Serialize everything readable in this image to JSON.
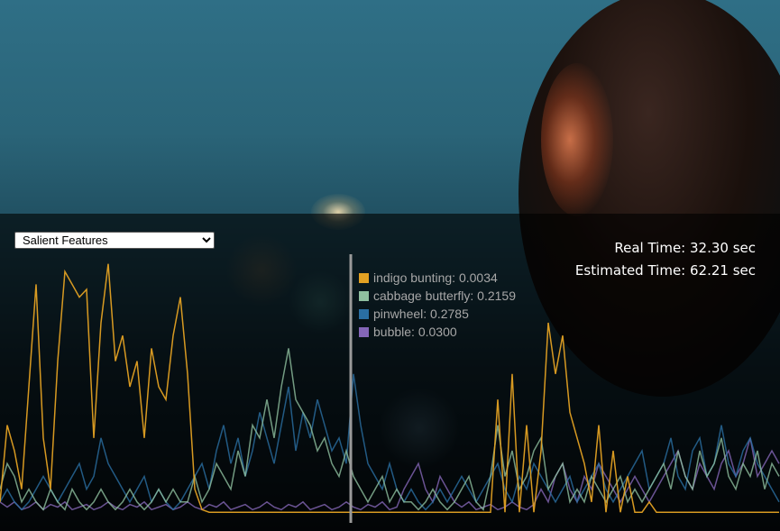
{
  "selector": {
    "selected": "Salient Features"
  },
  "timing": {
    "real_time": "Real Time: 32.30 sec",
    "estimated_time": "Estimated Time: 62.21 sec"
  },
  "legend": [
    {
      "label": "indigo bunting: 0.0034",
      "color": "#e3a123"
    },
    {
      "label": "cabbage butterfly: 0.2159",
      "color": "#8fbf9f"
    },
    {
      "label": "pinwheel: 0.2785",
      "color": "#2a6fa3"
    },
    {
      "label": "bubble: 0.0300",
      "color": "#8466b7"
    }
  ],
  "chart_data": {
    "type": "line",
    "ylim": [
      0,
      1
    ],
    "x": [
      0,
      8,
      16,
      24,
      32,
      40,
      48,
      56,
      64,
      72,
      80,
      88,
      96,
      104,
      112,
      120,
      128,
      136,
      144,
      152,
      160,
      168,
      176,
      184,
      192,
      200,
      208,
      216,
      224,
      232,
      240,
      248,
      256,
      264,
      272,
      280,
      288,
      296,
      304,
      312,
      320,
      328,
      336,
      344,
      352,
      360,
      368,
      376,
      384,
      392,
      400,
      408,
      416,
      424,
      432,
      440,
      448,
      456,
      464,
      472,
      480,
      488,
      496,
      504,
      512,
      520,
      528,
      536,
      544,
      552,
      560,
      568,
      576,
      584,
      592,
      600,
      608,
      616,
      624,
      632,
      640,
      648,
      656,
      664,
      672,
      680,
      688,
      696,
      704,
      712,
      720,
      728,
      736,
      744,
      752,
      760,
      768,
      776,
      784,
      792,
      800,
      808,
      816,
      824,
      832,
      840,
      848,
      856,
      864
    ],
    "playhead_x": 389,
    "series": [
      {
        "name": "indigo bunting",
        "color": "#e3a123",
        "values": [
          0.05,
          0.35,
          0.25,
          0.1,
          0.5,
          0.9,
          0.3,
          0.1,
          0.6,
          0.95,
          0.9,
          0.85,
          0.88,
          0.3,
          0.75,
          0.98,
          0.6,
          0.7,
          0.5,
          0.6,
          0.3,
          0.65,
          0.5,
          0.45,
          0.7,
          0.85,
          0.55,
          0.1,
          0.02,
          0.01,
          0.01,
          0.01,
          0.01,
          0.01,
          0.01,
          0.01,
          0.01,
          0.01,
          0.01,
          0.01,
          0.01,
          0.01,
          0.01,
          0.01,
          0.01,
          0.01,
          0.01,
          0.01,
          0.01,
          0.01,
          0.01,
          0.01,
          0.01,
          0.01,
          0.01,
          0.01,
          0.01,
          0.01,
          0.01,
          0.01,
          0.01,
          0.01,
          0.01,
          0.01,
          0.01,
          0.01,
          0.01,
          0.01,
          0.01,
          0.45,
          0.01,
          0.55,
          0.01,
          0.35,
          0.01,
          0.25,
          0.75,
          0.55,
          0.7,
          0.4,
          0.3,
          0.2,
          0.05,
          0.35,
          0.01,
          0.25,
          0.01,
          0.15,
          0.01,
          0.01,
          0.05,
          0.01,
          0.01,
          0.01,
          0.01,
          0.01,
          0.01,
          0.01,
          0.01,
          0.01,
          0.01,
          0.01,
          0.01,
          0.01,
          0.01,
          0.01,
          0.01,
          0.01,
          0.01
        ]
      },
      {
        "name": "cabbage butterfly",
        "color": "#8fbf9f",
        "values": [
          0.1,
          0.2,
          0.15,
          0.05,
          0.1,
          0.05,
          0.02,
          0.1,
          0.05,
          0.02,
          0.1,
          0.05,
          0.02,
          0.05,
          0.1,
          0.05,
          0.02,
          0.05,
          0.1,
          0.05,
          0.02,
          0.05,
          0.1,
          0.05,
          0.1,
          0.05,
          0.05,
          0.15,
          0.05,
          0.1,
          0.2,
          0.15,
          0.1,
          0.25,
          0.15,
          0.35,
          0.3,
          0.45,
          0.3,
          0.5,
          0.65,
          0.45,
          0.4,
          0.35,
          0.25,
          0.3,
          0.2,
          0.15,
          0.25,
          0.15,
          0.1,
          0.05,
          0.1,
          0.15,
          0.05,
          0.1,
          0.05,
          0.05,
          0.02,
          0.05,
          0.1,
          0.05,
          0.02,
          0.05,
          0.1,
          0.15,
          0.05,
          0.02,
          0.15,
          0.35,
          0.15,
          0.25,
          0.1,
          0.15,
          0.25,
          0.3,
          0.1,
          0.15,
          0.2,
          0.05,
          0.1,
          0.05,
          0.15,
          0.1,
          0.05,
          0.1,
          0.15,
          0.05,
          0.1,
          0.05,
          0.1,
          0.15,
          0.2,
          0.1,
          0.25,
          0.15,
          0.1,
          0.25,
          0.15,
          0.2,
          0.3,
          0.15,
          0.1,
          0.2,
          0.15,
          0.25,
          0.1,
          0.2,
          0.15
        ]
      },
      {
        "name": "pinwheel",
        "color": "#2a6fa3",
        "values": [
          0.05,
          0.1,
          0.05,
          0.02,
          0.05,
          0.1,
          0.15,
          0.1,
          0.05,
          0.1,
          0.15,
          0.2,
          0.1,
          0.15,
          0.3,
          0.2,
          0.15,
          0.1,
          0.05,
          0.1,
          0.15,
          0.05,
          0.1,
          0.05,
          0.02,
          0.05,
          0.1,
          0.15,
          0.2,
          0.1,
          0.25,
          0.35,
          0.2,
          0.3,
          0.15,
          0.25,
          0.4,
          0.3,
          0.2,
          0.35,
          0.5,
          0.25,
          0.4,
          0.3,
          0.45,
          0.35,
          0.25,
          0.3,
          0.2,
          0.55,
          0.35,
          0.2,
          0.15,
          0.1,
          0.2,
          0.1,
          0.05,
          0.1,
          0.05,
          0.02,
          0.05,
          0.1,
          0.05,
          0.1,
          0.15,
          0.1,
          0.05,
          0.1,
          0.15,
          0.2,
          0.1,
          0.05,
          0.15,
          0.1,
          0.2,
          0.15,
          0.1,
          0.05,
          0.1,
          0.15,
          0.05,
          0.1,
          0.15,
          0.2,
          0.1,
          0.05,
          0.1,
          0.15,
          0.2,
          0.25,
          0.1,
          0.15,
          0.2,
          0.3,
          0.15,
          0.1,
          0.25,
          0.3,
          0.15,
          0.2,
          0.35,
          0.2,
          0.15,
          0.25,
          0.3,
          0.2,
          0.15,
          0.1,
          0.05
        ]
      },
      {
        "name": "bubble",
        "color": "#8466b7",
        "values": [
          0.05,
          0.03,
          0.05,
          0.02,
          0.03,
          0.05,
          0.02,
          0.04,
          0.03,
          0.05,
          0.02,
          0.03,
          0.04,
          0.02,
          0.03,
          0.05,
          0.03,
          0.02,
          0.04,
          0.03,
          0.05,
          0.02,
          0.03,
          0.04,
          0.02,
          0.03,
          0.05,
          0.03,
          0.02,
          0.04,
          0.03,
          0.05,
          0.02,
          0.03,
          0.04,
          0.02,
          0.03,
          0.05,
          0.03,
          0.02,
          0.04,
          0.03,
          0.05,
          0.02,
          0.03,
          0.04,
          0.02,
          0.03,
          0.05,
          0.03,
          0.02,
          0.04,
          0.03,
          0.05,
          0.02,
          0.03,
          0.1,
          0.15,
          0.2,
          0.1,
          0.05,
          0.15,
          0.1,
          0.05,
          0.03,
          0.05,
          0.02,
          0.03,
          0.04,
          0.02,
          0.03,
          0.05,
          0.03,
          0.02,
          0.04,
          0.1,
          0.05,
          0.15,
          0.2,
          0.1,
          0.05,
          0.15,
          0.1,
          0.2,
          0.15,
          0.1,
          0.05,
          0.1,
          0.15,
          0.1,
          0.05,
          0.1,
          0.15,
          0.2,
          0.25,
          0.15,
          0.1,
          0.2,
          0.15,
          0.1,
          0.2,
          0.25,
          0.15,
          0.2,
          0.3,
          0.15,
          0.2,
          0.25,
          0.2
        ]
      }
    ]
  }
}
